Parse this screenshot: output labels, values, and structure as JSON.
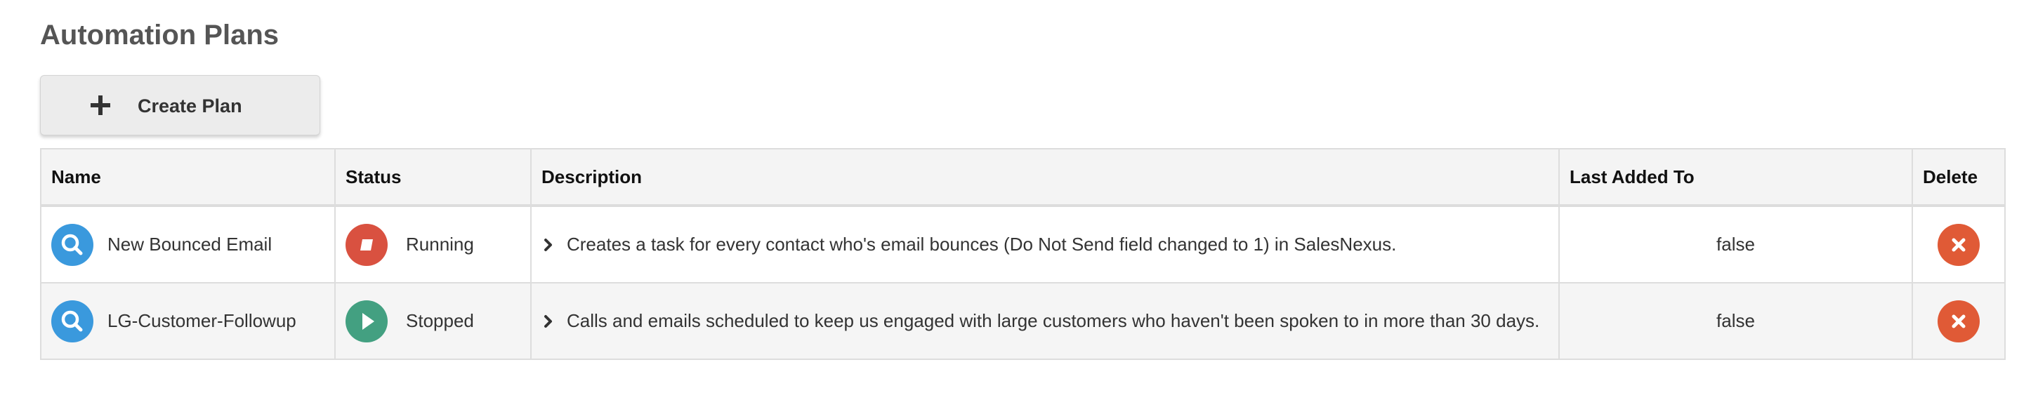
{
  "page": {
    "title": "Automation Plans",
    "create_button": "Create Plan"
  },
  "table": {
    "headers": {
      "name": "Name",
      "status": "Status",
      "description": "Description",
      "last_added_to": "Last Added To",
      "delete": "Delete"
    },
    "rows": [
      {
        "name": "New Bounced Email",
        "status": "Running",
        "status_icon": "stop-icon",
        "description": "Creates a task for every contact who's email bounces (Do Not Send field changed to 1) in SalesNexus.",
        "last_added_to": "false"
      },
      {
        "name": "LG-Customer-Followup",
        "status": "Stopped",
        "status_icon": "play-icon",
        "description": "Calls and emails scheduled to keep us engaged with large customers who haven't been spoken to in more than 30 days.",
        "last_added_to": "false"
      }
    ]
  },
  "colors": {
    "view_button": "#3a99dd",
    "running_status": "#d95140",
    "stopped_status": "#43a081",
    "delete_button": "#e05a36",
    "header_bg": "#f4f4f4",
    "row_alt_bg": "#f5f5f5",
    "border": "#dddddd"
  }
}
